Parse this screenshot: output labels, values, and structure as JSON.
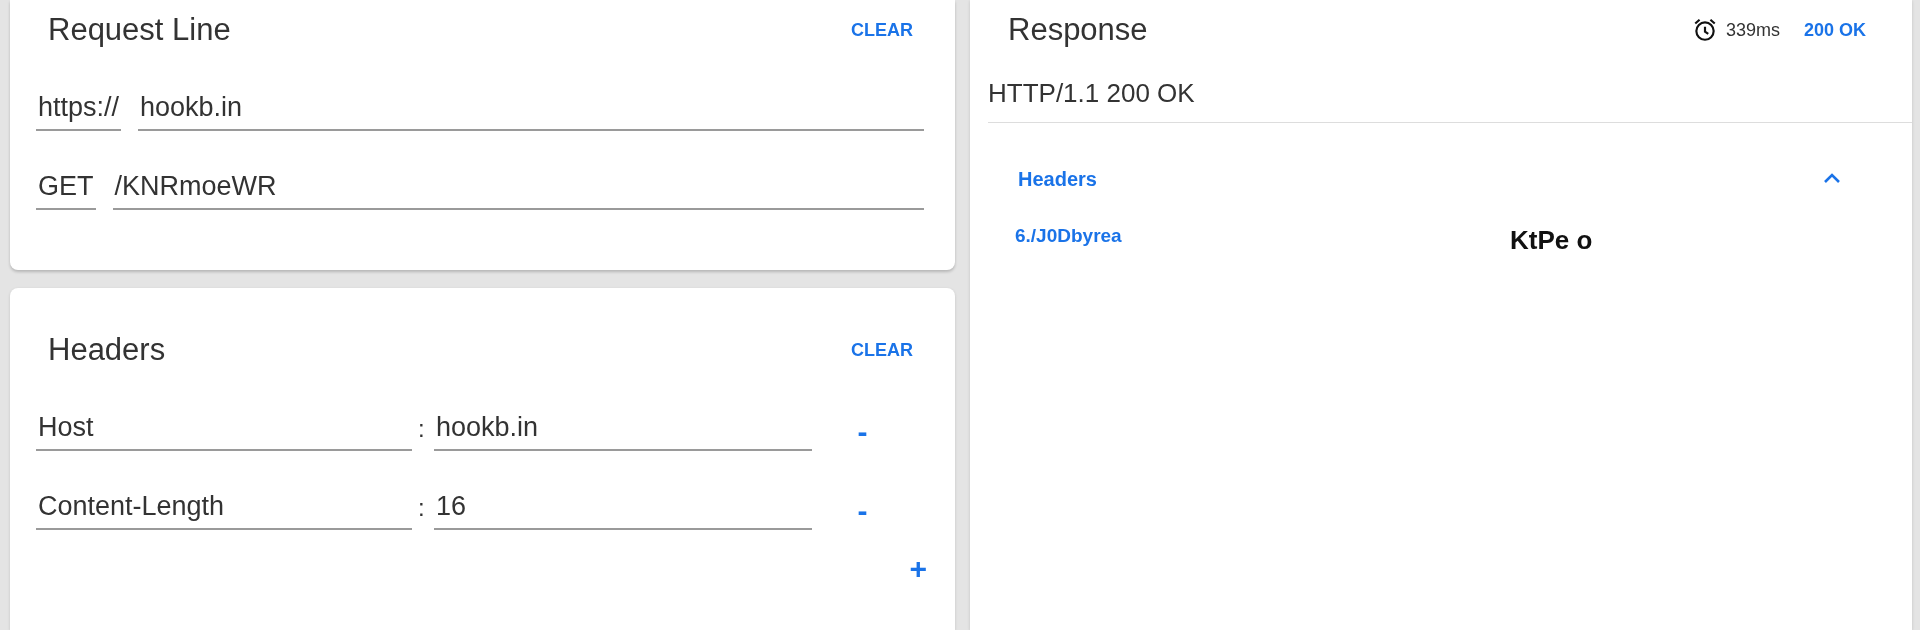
{
  "request_line": {
    "title": "Request Line",
    "clear_label": "CLEAR",
    "scheme": "https://",
    "host": "hookb.in",
    "method": "GET",
    "path": "/KNRmoeWR"
  },
  "headers": {
    "title": "Headers",
    "clear_label": "CLEAR",
    "rows": [
      {
        "name": "Host",
        "separator": ":",
        "value": "hookb.in",
        "remove_label": "-"
      },
      {
        "name": "Content-Length",
        "separator": ":",
        "value": "16",
        "remove_label": "-"
      }
    ],
    "add_label": "+"
  },
  "response": {
    "title": "Response",
    "time": "339ms",
    "status": "200 OK",
    "status_line": "HTTP/1.1 200 OK",
    "headers_section": {
      "title": "Headers",
      "expanded": true,
      "rows": [
        {
          "name": "6./J0Dbyrea",
          "value": "KtPe o"
        }
      ]
    }
  }
}
